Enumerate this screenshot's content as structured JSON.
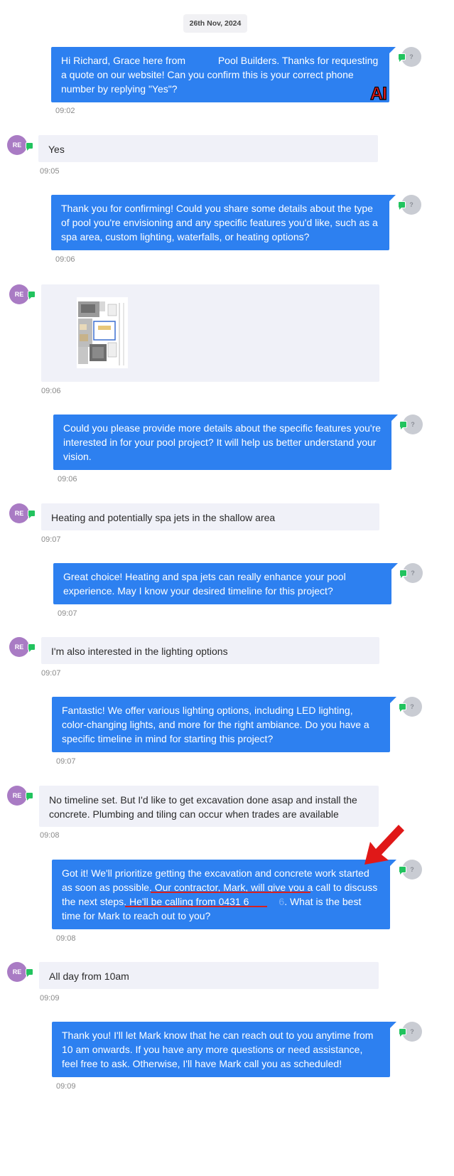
{
  "date_label": "26th Nov, 2024",
  "agent_avatar_initial": "?",
  "user_avatar_initials": "RE",
  "ai_watermark": "AI",
  "messages": [
    {
      "text_pre": "Hi Richard, Grace here from ",
      "text_post": " Pool Builders. Thanks for requesting a quote on our website! Can you confirm this is your correct phone number by replying \"Yes\"?",
      "time": "09:02"
    },
    {
      "text": "Yes",
      "time": "09:05"
    },
    {
      "text": "Thank you for confirming! Could you share some details about the type of pool you're envisioning and any specific features you'd like, such as a spa area, custom lighting, waterfalls, or heating options?",
      "time": "09:06"
    },
    {
      "text": "",
      "time": "09:06"
    },
    {
      "text": "Could you please provide more details about the specific features you're interested in for your pool project? It will help us better understand your vision.",
      "time": "09:06"
    },
    {
      "text": "Heating and potentially spa jets in the shallow area",
      "time": "09:07"
    },
    {
      "text": "Great choice! Heating and spa jets can really enhance your pool experience. May I know your desired timeline for this project?",
      "time": "09:07"
    },
    {
      "text": "I'm also interested in the lighting options",
      "time": "09:07"
    },
    {
      "text": "Fantastic! We offer various lighting options, including LED lighting, color-changing lights, and more for the right ambiance. Do you have a specific timeline in mind for starting this project?",
      "time": "09:07"
    },
    {
      "text": "No timeline set. But I'd like to get excavation done asap and install the concrete. Plumbing and tiling can occur when trades are available",
      "time": "09:08"
    },
    {
      "text_a": "Got it! We'll prioritize getting the excavation and concrete work started as soon as possible. ",
      "text_b": "Our contractor, Mark, will give you a call",
      "text_c": " to discuss the next steps. ",
      "text_d": "He'll be calling from 0431 6",
      "text_e": "6",
      "text_f": ". What is the best time for Mark to reach out to you?",
      "time": "09:08"
    },
    {
      "text": "All day from 10am",
      "time": "09:09"
    },
    {
      "text": "Thank you! I'll let Mark know that he can reach out to you anytime from 10 am onwards. If you have any more questions or need assistance, feel free to ask. Otherwise, I'll have Mark call you as scheduled!",
      "time": "09:09"
    }
  ],
  "colors": {
    "agent_bubble": "#2d80f0",
    "user_bubble": "#f0f1f8",
    "user_avatar": "#a97bc4",
    "agent_avatar": "#c9ccd3",
    "channel_badge": "#22c35e",
    "annotation_red": "#d62020"
  },
  "icons": {
    "channel_badge": "sms-chat-bubble-icon",
    "annotation_arrow": "red-arrow-icon",
    "attachment": "floor-plan-image"
  }
}
